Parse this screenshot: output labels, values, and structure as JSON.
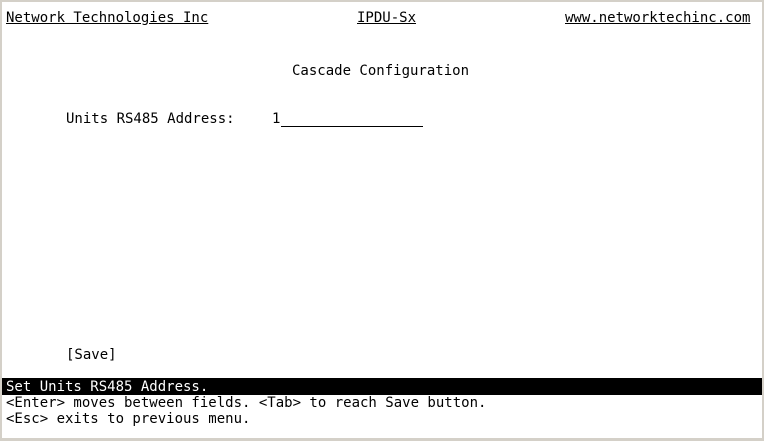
{
  "header": {
    "company": "Network Technologies Inc",
    "product": "IPDU-Sx",
    "website": "www.networktechinc.com"
  },
  "screen": {
    "title": "Cascade Configuration"
  },
  "form": {
    "rs485_label": "Units RS485 Address:",
    "rs485_value": "1"
  },
  "save_button": "[Save]",
  "status": {
    "message": "Set Units RS485 Address."
  },
  "help": {
    "line1": "<Enter> moves between fields. <Tab> to reach Save button.",
    "line2": "<Esc> exits to previous menu."
  }
}
